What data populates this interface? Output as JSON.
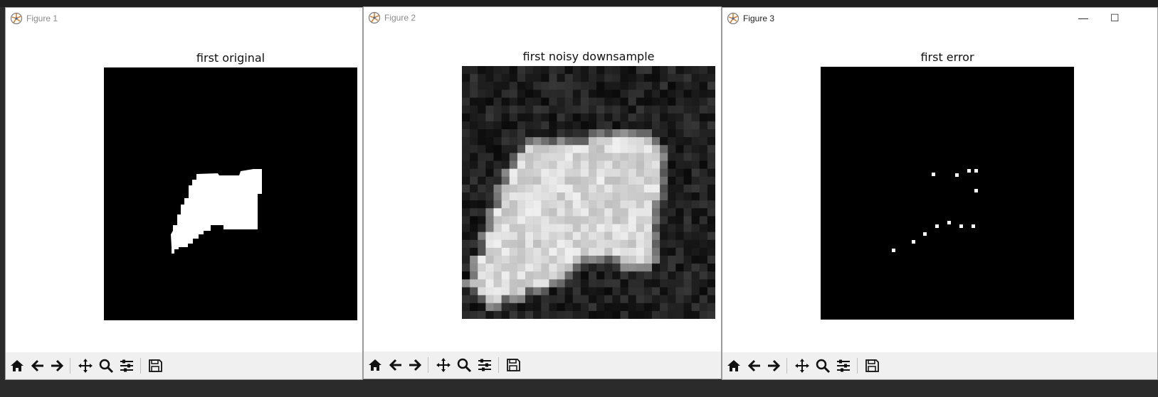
{
  "windows": [
    {
      "id": "fig1",
      "title": "Figure 1",
      "plot_title": "first original",
      "image": "binary-shape-mask"
    },
    {
      "id": "fig2",
      "title": "Figure 2",
      "plot_title": "first noisy downsample",
      "image": "noisy-grayscale-blob"
    },
    {
      "id": "fig3",
      "title": "Figure 3",
      "plot_title": "first error",
      "image": "sparse-error-pixels"
    }
  ],
  "toolbar_buttons": [
    {
      "name": "home-icon"
    },
    {
      "name": "back-arrow-icon"
    },
    {
      "name": "forward-arrow-icon"
    },
    {
      "name": "pan-move-icon"
    },
    {
      "name": "zoom-magnifier-icon"
    },
    {
      "name": "configure-subplots-icon"
    },
    {
      "name": "save-floppy-icon"
    }
  ],
  "window_controls": {
    "minimize": "—",
    "maximize": "☐"
  },
  "colors": {
    "plot_bg": "#000000",
    "foreground": "#ffffff",
    "toolbar_bg": "#f0f0f0"
  }
}
